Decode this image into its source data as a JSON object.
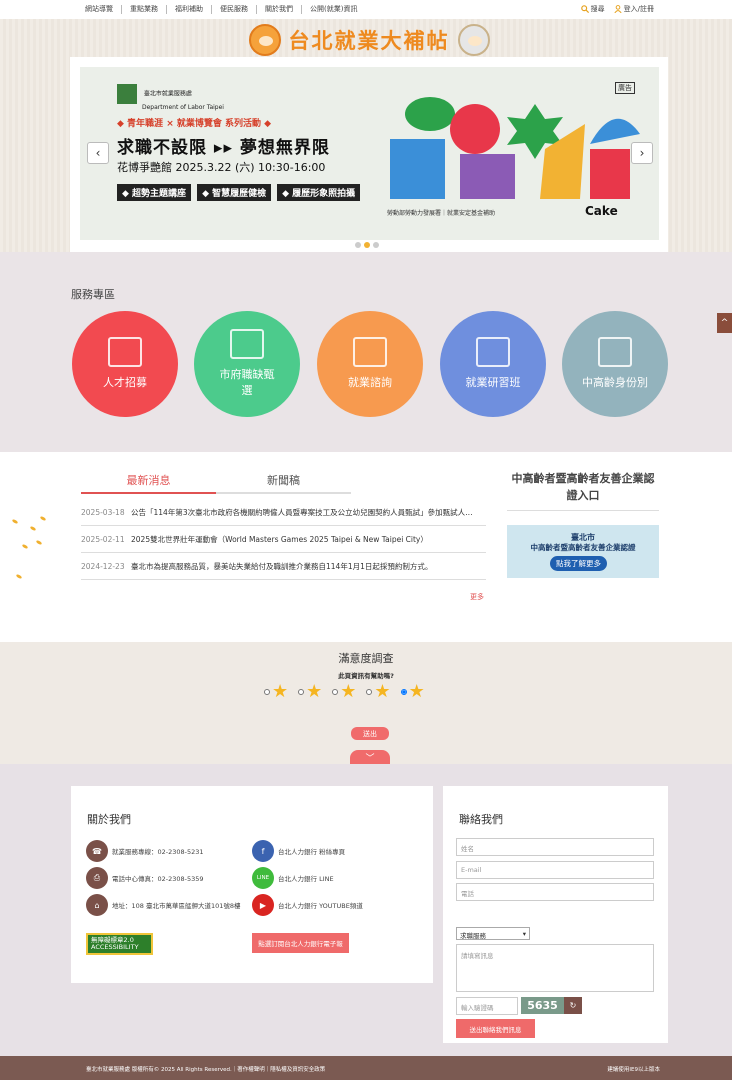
{
  "topnav": {
    "items": [
      "網站導覽",
      "重點業務",
      "福利補助",
      "便民服務",
      "關於我們",
      "公開(就業)資訊"
    ],
    "search": "搜尋",
    "login": "登入/註冊"
  },
  "header": {
    "logo_text": "台北就業大補帖"
  },
  "banner": {
    "org_line1": "臺北市就業服務處",
    "org_line2": "Department of Labor Taipei",
    "series": "◆ 青年職涯 × 就業博覽會 系列活動 ◆",
    "slogan": "求職不設限 ▸▸ 夢想無界限",
    "date": "花博爭艷館  2025.3.22 (六) 10:30-16:00",
    "tags": [
      "◆ 超勢主題講座",
      "◆ 智慧履歷健檢",
      "◆ 履歷形象照拍攝"
    ],
    "ad": "廣告",
    "footnote": "勞動部勞動力發展署｜就業安定基金補助",
    "cake": "Cake",
    "prev": "‹",
    "next": "›"
  },
  "services": {
    "title": "服務專區",
    "items": [
      {
        "label": "人才招募",
        "color": "#f24a50"
      },
      {
        "label": "市府職缺甄選",
        "color": "#4ccb8c"
      },
      {
        "label": "就業諮詢",
        "color": "#f79a4f"
      },
      {
        "label": "就業研習班",
        "color": "#6f8fde"
      },
      {
        "label": "中高齡身份別",
        "color": "#93b3bd"
      }
    ],
    "side_up": "^"
  },
  "news": {
    "tabs": [
      "最新消息",
      "新聞稿"
    ],
    "rows": [
      {
        "date": "2025-03-18",
        "title": "公告「114年第3次臺北市政府各機關約聘僱人員暨專案技工及公立幼兒園契約人員甄試」參加甄試人…"
      },
      {
        "date": "2025-02-11",
        "title": "2025雙北世界壯年運動會（World Masters Games 2025 Taipei & New Taipei City）"
      },
      {
        "date": "2024-12-23",
        "title": "臺北市為提高服務品質，暴美站失業給付及職訓推介業務自114年1月1日起採預約制方式。"
      }
    ],
    "more": "更多"
  },
  "senior": {
    "title": "中高齡者暨高齡者友善企業認證入口",
    "banner_l1": "臺北市",
    "banner_l2": "中高齡者暨高齡者友善企業認證",
    "banner_btn": "點我了解更多"
  },
  "survey": {
    "title": "滿意度調查",
    "question": "此頁資訊有幫助嗎?",
    "options": 5,
    "selected": 5,
    "send": "送出",
    "down": "﹀"
  },
  "about": {
    "title": "關於我們",
    "left_rows": [
      {
        "icon": "phone-icon",
        "glyph": "☎",
        "text": "就業服務專線：02-2308-5231"
      },
      {
        "icon": "fax-icon",
        "glyph": "⎙",
        "text": "電話中心傳真：02-2308-5359"
      },
      {
        "icon": "home-icon",
        "glyph": "⌂",
        "text": "地址：108 臺北市萬華區艋舺大道101號8樓"
      }
    ],
    "right_rows": [
      {
        "icon": "facebook-icon",
        "glyph": "f",
        "text": "台北人力銀行 粉絲專頁"
      },
      {
        "icon": "line-icon",
        "glyph": "LINE",
        "text": "台北人力銀行 LINE"
      },
      {
        "icon": "youtube-icon",
        "glyph": "▶",
        "text": "台北人力銀行 YOUTUBE頻道"
      }
    ],
    "a11y_l1": "無障礙標章2.0",
    "a11y_l2": "ACCESSIBILITY",
    "subscribe": "點選訂閱台北人力銀行電子報"
  },
  "contact": {
    "title": "聯絡我們",
    "name_ph": "姓名",
    "email_ph": "E-mail",
    "phone_ph": "電話",
    "select_value": "求職服務",
    "message_ph": "請填寫訊息",
    "captcha_ph": "輸入驗證碼",
    "captcha_code": "5635",
    "refresh": "↻",
    "send": "送出聯絡我們訊息"
  },
  "bottom": {
    "left": "臺北市就業服務處 版權所有© 2025 All Rights Reserved.｜著作權聲明｜隱私權及資訊安全政策",
    "right": "建議使用IE9以上版本"
  }
}
